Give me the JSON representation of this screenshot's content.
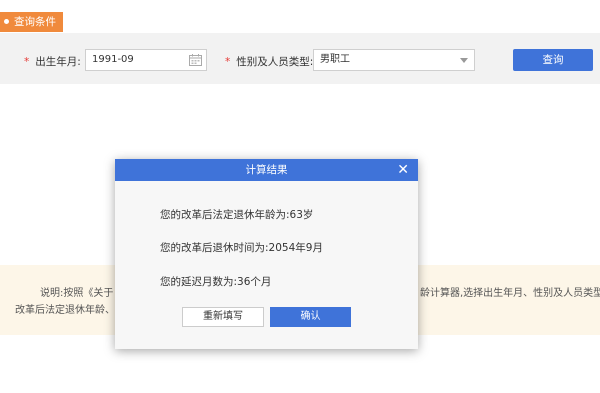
{
  "section_tag": {
    "label": "查询条件"
  },
  "form": {
    "birth_label": "出生年月:",
    "birth_value": "1991-09",
    "type_label": "性别及人员类型:",
    "type_value": "男职工",
    "required_mark": "*",
    "query_button": "查询"
  },
  "notice": {
    "line1_start": "说明:按照《关于",
    "line1_end": "龄计算器,选择出生年月、性别及人员类型,",
    "line2_start": "改革后法定退休年龄、",
    "line2_end": ""
  },
  "dialog": {
    "title": "计算结果",
    "close_glyph": "✕",
    "results": [
      "您的改革后法定退休年龄为:63岁",
      "您的改革后退休时间为:2054年9月",
      "您的延迟月数为:36个月"
    ],
    "reset_button": "重新填写",
    "confirm_button": "确认"
  }
}
